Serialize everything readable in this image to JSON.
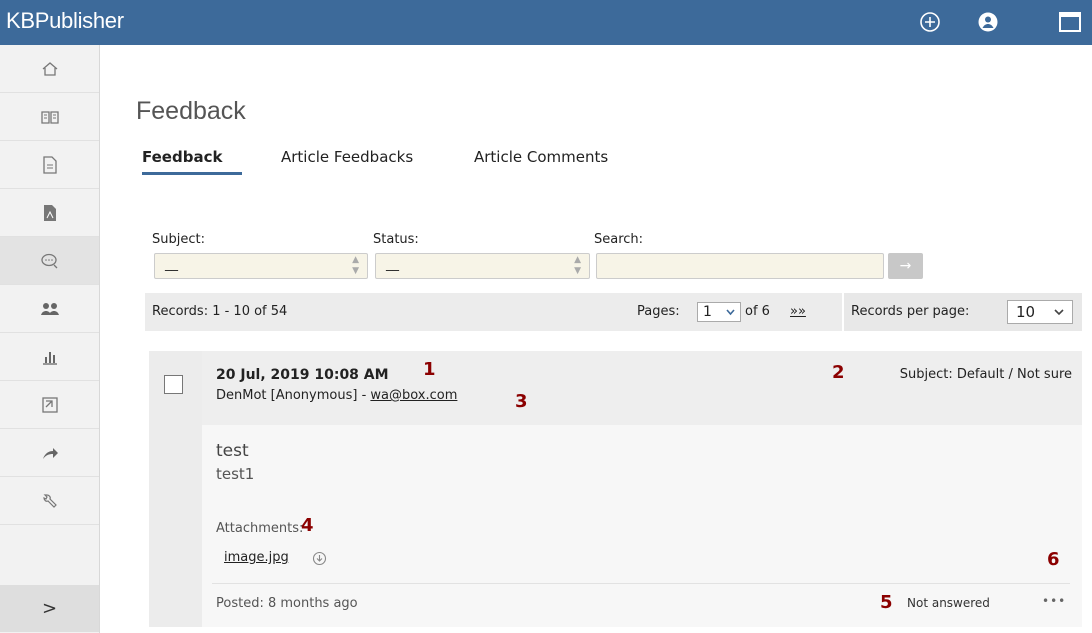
{
  "app": {
    "brand": "KBPublisher"
  },
  "topbar": {
    "icons": [
      "plus-circle-icon",
      "user-circle-icon",
      "window-icon"
    ]
  },
  "sidebar": {
    "items": [
      {
        "icon": "home-icon"
      },
      {
        "icon": "book-icon"
      },
      {
        "icon": "document-icon"
      },
      {
        "icon": "pdf-file-icon"
      },
      {
        "icon": "comments-icon"
      },
      {
        "icon": "users-icon"
      },
      {
        "icon": "bar-chart-icon"
      },
      {
        "icon": "import-icon"
      },
      {
        "icon": "share-arrow-icon"
      },
      {
        "icon": "wrench-icon"
      }
    ],
    "expand_glyph": ">"
  },
  "page": {
    "title": "Feedback",
    "tabs": [
      {
        "label": "Feedback",
        "active": true
      },
      {
        "label": "Article Feedbacks",
        "active": false
      },
      {
        "label": "Article Comments",
        "active": false
      }
    ]
  },
  "filters": {
    "subject_label": "Subject:",
    "subject_value": "__",
    "status_label": "Status:",
    "status_value": "__",
    "search_label": "Search:",
    "search_value": "",
    "go_glyph": "→"
  },
  "records": {
    "summary": "Records: 1 - 10 of 54",
    "pages_label": "Pages:",
    "page_value": "1",
    "of_text": "of 6",
    "next_glyph": "»»",
    "per_page_label": "Records per page:",
    "per_page_value": "10"
  },
  "feedback_item": {
    "date": "20 Jul, 2019 10:08 AM",
    "author": "DenMot [Anonymous] - ",
    "email": "wa@box.com",
    "subject_text": "Subject: Default / Not sure",
    "title": "test",
    "body": "test1",
    "attachments_label": "Attachments:",
    "attachment_name": "image.jpg",
    "posted": "Posted: 8 months ago",
    "status": "Not answered",
    "more_glyph": "•••"
  },
  "annotations": [
    "1",
    "2",
    "3",
    "4",
    "5",
    "6"
  ],
  "colors": {
    "topbar": "#3d6a9a",
    "annotation": "#8b0000",
    "field_bg": "#f7f4e7"
  }
}
